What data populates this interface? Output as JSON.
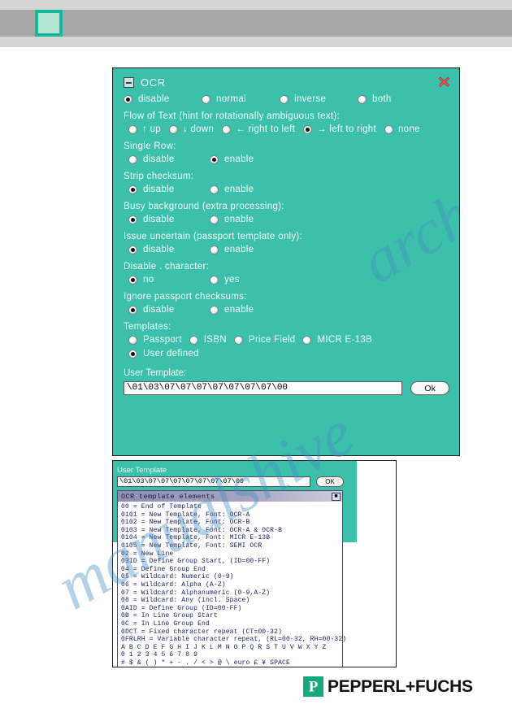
{
  "header": {
    "square_icon": "green-square-icon",
    "band_color": "#a8a8a8"
  },
  "watermark": {
    "line1": "archive.com",
    "line2": "manualshive"
  },
  "ocr_panel": {
    "title": "OCR",
    "collapse_icon": "collapse-minus-icon",
    "close_icon": "close-x-icon",
    "accent_color": "#3cc0ac",
    "mode": {
      "options": [
        {
          "label": "disable",
          "selected": true
        },
        {
          "label": "normal",
          "selected": false
        },
        {
          "label": "inverse",
          "selected": false
        },
        {
          "label": "both",
          "selected": false
        }
      ]
    },
    "flow_of_text": {
      "label": "Flow of Text (hint for rotationally ambiguous text):",
      "options": [
        {
          "label": "↑ up",
          "selected": false
        },
        {
          "label": "↓ down",
          "selected": false
        },
        {
          "label": "← right to left",
          "selected": false
        },
        {
          "label": "→ left to right",
          "selected": true
        },
        {
          "label": "none",
          "selected": false
        }
      ]
    },
    "single_row": {
      "label": "Single Row:",
      "options": [
        {
          "label": "disable",
          "selected": false
        },
        {
          "label": "enable",
          "selected": true
        }
      ]
    },
    "strip_checksum": {
      "label": "Strip checksum:",
      "options": [
        {
          "label": "disable",
          "selected": true
        },
        {
          "label": "enable",
          "selected": false
        }
      ]
    },
    "busy_background": {
      "label": "Busy background (extra processing):",
      "options": [
        {
          "label": "disable",
          "selected": true
        },
        {
          "label": "enable",
          "selected": false
        }
      ]
    },
    "issue_uncertain": {
      "label": "Issue uncertain (passport template only):",
      "options": [
        {
          "label": "disable",
          "selected": true
        },
        {
          "label": "enable",
          "selected": false
        }
      ]
    },
    "disable_character": {
      "label": "Disable . character:",
      "options": [
        {
          "label": "no",
          "selected": true
        },
        {
          "label": "yes",
          "selected": false
        }
      ]
    },
    "ignore_passport_checksums": {
      "label": "Ignore passport checksums:",
      "options": [
        {
          "label": "disable",
          "selected": true
        },
        {
          "label": "enable",
          "selected": false
        }
      ]
    },
    "templates": {
      "label": "Templates:",
      "options": [
        {
          "label": "Passport",
          "selected": false
        },
        {
          "label": "ISBN",
          "selected": false
        },
        {
          "label": "Price Field",
          "selected": false
        },
        {
          "label": "MICR E-13B",
          "selected": false
        },
        {
          "label": "User defined",
          "selected": true
        }
      ]
    },
    "user_template": {
      "label": "User Template:",
      "value": "\\01\\03\\07\\07\\07\\07\\07\\07\\07\\00",
      "ok_label": "Ok"
    }
  },
  "lower_figure": {
    "user_template_label": "User Template",
    "user_template_value": "\\01\\03\\07\\07\\07\\07\\07\\07\\07\\00",
    "ok_label": "OK",
    "list_window": {
      "title": "OCR template elements",
      "title_button": "maximize-icon",
      "lines": [
        "00 = End of Template",
        "0101 = New Template, Font: OCR-A",
        "0102 = New Template, Font: OCR-B",
        "0103 = New Template, Font: OCR-A & OCR-B",
        "0104 = New Template, Font: MICR E-13B",
        "0105 = New Template, Font: SEMI OCR",
        "02 = New Line",
        "03ID = Define Group Start, (ID=00-FF)",
        "04 = Define Group End",
        "05 = Wildcard: Numeric (0-9)",
        "06 = Wildcard: Alpha (A-Z)",
        "07 = Wildcard: Alphanumeric (0-9,A-Z)",
        "08 = Wildcard: Any (incl. Space)",
        "0AID = Define Group (ID=00-FF)",
        "0B = In Line Group Start",
        "0C = In Line Group End",
        "0DCT = Fixed character repeat (CT=00-32)",
        "0FRLRH = Variable character repeat, (RL=00-32, RH=00-32)",
        "A B C D E F G H I J K L M N O P Q R S T U V W X Y Z",
        "0 1 2 3 4 5 6 7 8 9",
        "# $ & ( ) * + - . / < > @ \\ euro £ ¥ SPACE"
      ]
    }
  },
  "footer": {
    "logo_glyph": "P",
    "logo_text": "PEPPERL+FUCHS"
  }
}
